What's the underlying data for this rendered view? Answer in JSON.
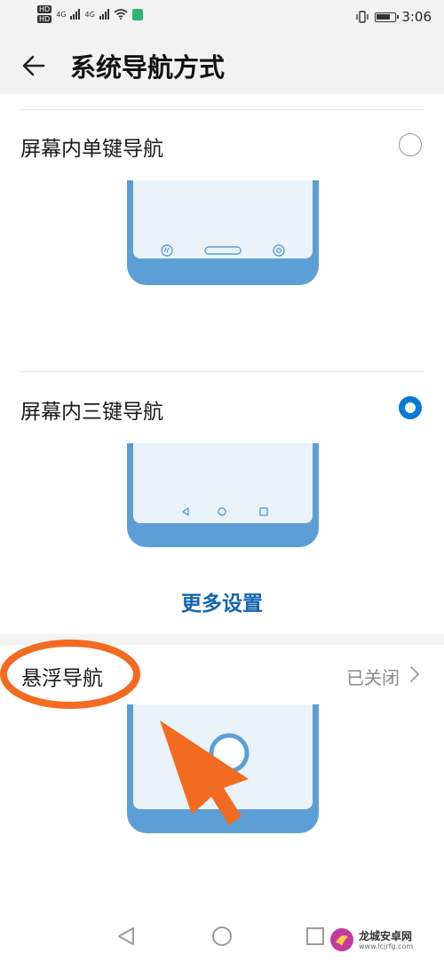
{
  "status_bar": {
    "hd_badges": [
      "HD",
      "HD"
    ],
    "network_labels": [
      "4G",
      "4G"
    ],
    "time": "3:06",
    "icons": [
      "signal-icon",
      "wifi-icon",
      "sim-icon",
      "vibrate-icon",
      "battery-icon"
    ]
  },
  "app_bar": {
    "title": "系统导航方式",
    "back_icon": "back-arrow-icon"
  },
  "options": [
    {
      "label": "屏幕内单键导航",
      "selected": false
    },
    {
      "label": "屏幕内三键导航",
      "selected": true
    }
  ],
  "more_settings": {
    "label": "更多设置"
  },
  "floating_nav": {
    "label": "悬浮导航",
    "status": "已关闭"
  },
  "colors": {
    "accent": "#0a7ad8",
    "link": "#1565b0",
    "phone_frame": "#5c9fd7",
    "annotation": "#f26b21"
  },
  "watermark": {
    "name": "龙城安卓网",
    "url": "www.lcjrfg.com"
  }
}
